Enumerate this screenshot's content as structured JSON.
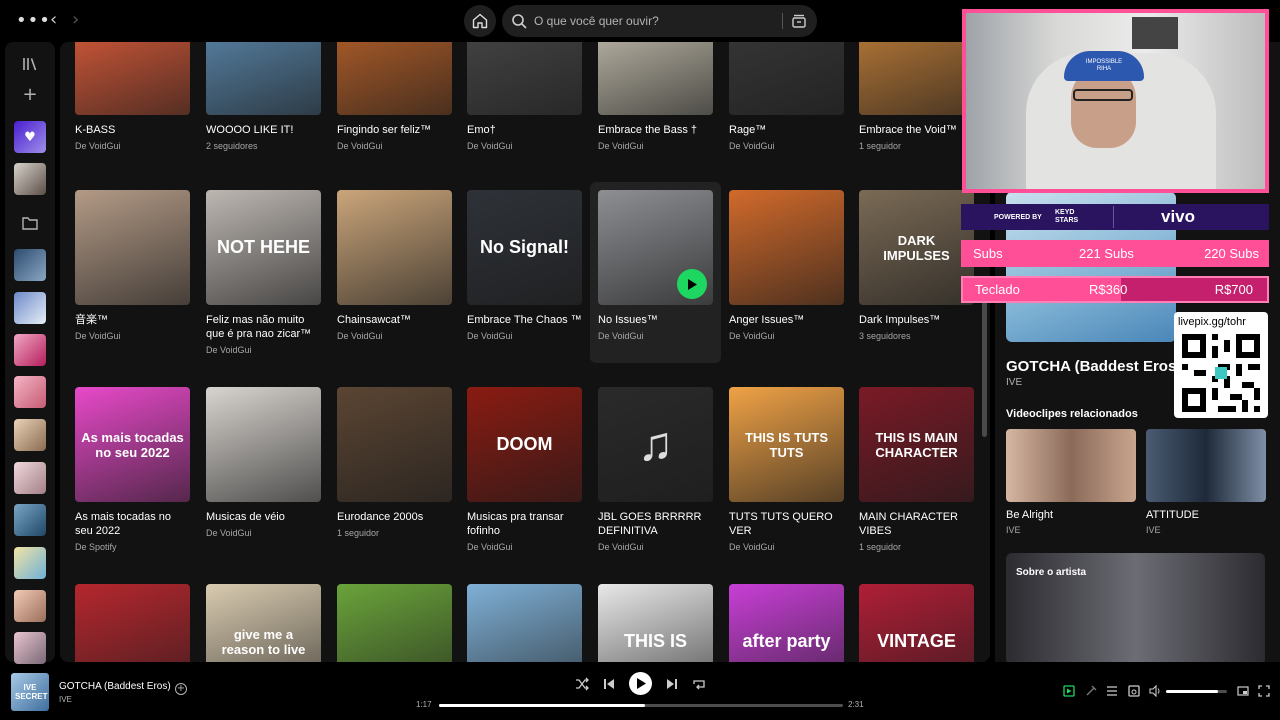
{
  "topbar": {
    "menu_icon": "more-icon",
    "back_icon": "back-icon",
    "forward_icon": "forward-icon",
    "search_placeholder": "O que você quer ouvir?"
  },
  "grid": {
    "row1": [
      {
        "title": "K-BASS",
        "sub": "De VoidGui",
        "color": "#e8603c"
      },
      {
        "title": "WOOOO LIKE IT!",
        "sub": "2 seguidores",
        "color": "#5f8fb6"
      },
      {
        "title": "Fingindo ser feliz™",
        "sub": "De VoidGui",
        "color": "#c0652a"
      },
      {
        "title": "Emo†",
        "sub": "De VoidGui",
        "color": "#4a4a4a"
      },
      {
        "title": "Embrace the Bass †",
        "sub": "De VoidGui",
        "color": "#cfc9b8"
      },
      {
        "title": "Rage™",
        "sub": "De VoidGui",
        "color": "#3a3a3a"
      },
      {
        "title": "Embrace the Void™",
        "sub": "1 seguidor",
        "color": "#c9833a"
      }
    ],
    "row2": [
      {
        "title": "音楽™",
        "sub": "De VoidGui",
        "color": "#b39a86",
        "overlay": ""
      },
      {
        "title": "Feliz mas não muito que é pra nao zicar™",
        "sub": "De VoidGui",
        "color": "#bdb7b2",
        "overlay": "NOT HEHE"
      },
      {
        "title": "Chainsawcat™",
        "sub": "De VoidGui",
        "color": "#caa57a",
        "overlay": ""
      },
      {
        "title": "Embrace The Chaos ™",
        "sub": "De VoidGui",
        "color": "#2e3238",
        "overlay": "No Signal!"
      },
      {
        "title": "No Issues™",
        "sub": "De VoidGui",
        "color": "#8d8f93",
        "overlay": ""
      },
      {
        "title": "Anger Issues™",
        "sub": "De VoidGui",
        "color": "#d16a2b",
        "overlay": ""
      },
      {
        "title": "Dark Impulses™",
        "sub": "3 seguidores",
        "color": "#7a6a55",
        "overlay": "DARK IMPULSES"
      }
    ],
    "row3": [
      {
        "title": "As mais tocadas no seu 2022",
        "sub": "De Spotify",
        "color": "#e849c9",
        "overlay": "As mais tocadas no seu 2022"
      },
      {
        "title": "Musicas de véio",
        "sub": "De VoidGui",
        "color": "#d8d4cf",
        "overlay": ""
      },
      {
        "title": "Eurodance 2000s",
        "sub": "1 seguidor",
        "color": "#5b4533",
        "overlay": ""
      },
      {
        "title": "Musicas pra transar fofinho",
        "sub": "De VoidGui",
        "color": "#8a1b12",
        "overlay": "DOOM"
      },
      {
        "title": "JBL GOES BRRRRR DEFINITIVA",
        "sub": "De VoidGui",
        "color": "#2a2a2a",
        "overlay": "♫"
      },
      {
        "title": "TUTS TUTS QUERO VER",
        "sub": "De VoidGui",
        "color": "#f0a246",
        "overlay": "THIS IS TUTS TUTS"
      },
      {
        "title": "MAIN CHARACTER VIBES",
        "sub": "1 seguidor",
        "color": "#7a1a26",
        "overlay": "THIS IS MAIN CHARACTER"
      }
    ],
    "row4": [
      {
        "color": "#b5272e",
        "overlay": ""
      },
      {
        "color": "#d9cbb0",
        "overlay": "give me a reason to live"
      },
      {
        "color": "#6aa33a",
        "overlay": ""
      },
      {
        "color": "#7fb0d6",
        "overlay": ""
      },
      {
        "color": "#e8e8e8",
        "overlay": "THIS IS"
      },
      {
        "color": "#c83fd6",
        "overlay": "after party"
      },
      {
        "color": "#b01e36",
        "overlay": "VINTAGE"
      }
    ]
  },
  "right_panel": {
    "song_title": "GOTCHA (Baddest Eros)",
    "artist": "IVE",
    "videos_heading": "Videoclipes relacionados",
    "videos": [
      {
        "title": "Be Alright",
        "artist": "IVE"
      },
      {
        "title": "ATTITUDE",
        "artist": "IVE"
      }
    ],
    "about_heading": "Sobre o artista"
  },
  "overlay": {
    "powered_by": "POWERED BY",
    "keyd": "KEYD STARS",
    "vivo": "vivo",
    "subs_label": "Subs",
    "subs_current": "221 Subs",
    "subs_goal": "220 Subs",
    "teclado_label": "Teclado",
    "teclado_current": "R$360",
    "teclado_goal": "R$700",
    "livepix": "livepix.gg/tohr",
    "cap_text": "IMPOSSIBLE RIHA"
  },
  "player": {
    "title": "GOTCHA (Baddest Eros)",
    "artist": "IVE",
    "cover_text": "IVE SECRET",
    "elapsed": "1:17",
    "total": "2:31",
    "progress": 0.51,
    "volume": 0.85
  }
}
